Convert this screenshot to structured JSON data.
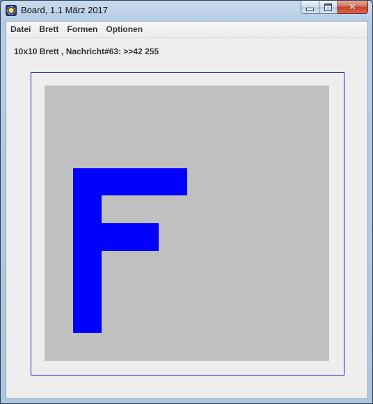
{
  "window": {
    "title": "Board, 1.1 März 2017",
    "controls": {
      "minimize_icon": "minimize-icon",
      "maximize_icon": "maximize-icon",
      "close_icon": "close-icon",
      "close_glyph": "✕"
    }
  },
  "menu": {
    "items": [
      {
        "label": "Datei"
      },
      {
        "label": "Brett"
      },
      {
        "label": "Formen"
      },
      {
        "label": "Optionen"
      }
    ]
  },
  "status": {
    "text": "10x10 Brett , Nachricht#63: >>42 255"
  },
  "board": {
    "rows": 10,
    "cols": 10,
    "empty_color": "#c0c0c0",
    "frame_color": "#1b1bb5",
    "filled_color": "#0000ff",
    "filled_cells": [
      [
        3,
        1
      ],
      [
        3,
        2
      ],
      [
        3,
        3
      ],
      [
        3,
        4
      ],
      [
        4,
        1
      ],
      [
        5,
        1
      ],
      [
        5,
        2
      ],
      [
        5,
        3
      ],
      [
        6,
        1
      ],
      [
        7,
        1
      ],
      [
        8,
        1
      ]
    ]
  }
}
